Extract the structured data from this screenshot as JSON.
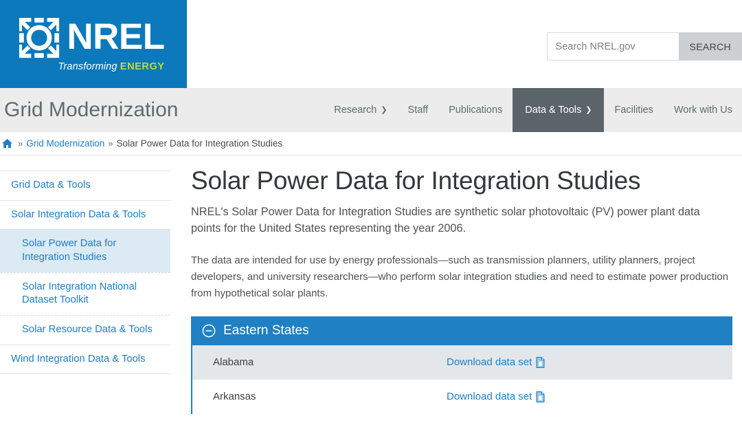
{
  "masthead": {
    "logo": {
      "mark_name": "nrel-ring-icon",
      "wordmark": "NREL",
      "tagline_prefix": "Transforming ",
      "tagline_accent": "ENERGY",
      "background": "#0b79bc",
      "accent_color": "#c8d92b"
    },
    "search": {
      "placeholder": "Search NREL.gov",
      "value": "",
      "button_label": "SEARCH"
    }
  },
  "nav": {
    "site_title": "Grid Modernization",
    "items": [
      {
        "label": "Research",
        "has_caret": true,
        "active": false
      },
      {
        "label": "Staff",
        "has_caret": false,
        "active": false
      },
      {
        "label": "Publications",
        "has_caret": false,
        "active": false
      },
      {
        "label": "Data & Tools",
        "has_caret": true,
        "active": true
      },
      {
        "label": "Facilities",
        "has_caret": false,
        "active": false
      },
      {
        "label": "Work with Us",
        "has_caret": false,
        "active": false
      }
    ],
    "active_background": "#5a6469"
  },
  "breadcrumb": {
    "home_icon": "home-icon",
    "separator": "»",
    "items": [
      {
        "label": "Grid Modernization",
        "is_link": true
      },
      {
        "label": "Solar Power Data for Integration Studies",
        "is_link": false
      }
    ]
  },
  "sidebar": {
    "items": [
      {
        "label": "Grid Data & Tools",
        "level": 1,
        "active": false
      },
      {
        "label": "Solar Integration Data & Tools",
        "level": 1,
        "active": false
      },
      {
        "label": "Solar Power Data for Integration Studies",
        "level": 2,
        "active": true
      },
      {
        "label": "Solar Integration National Dataset Toolkit",
        "level": 2,
        "active": false
      },
      {
        "label": "Solar Resource Data & Tools",
        "level": 2,
        "active": false
      },
      {
        "label": "Wind Integration Data & Tools",
        "level": 1,
        "active": false
      }
    ],
    "active_background": "#dceaf4",
    "link_color": "#1f7ec4"
  },
  "main": {
    "title": "Solar Power Data for Integration Studies",
    "lede": "NREL's Solar Power Data for Integration Studies are synthetic solar photovoltaic (PV) power plant data points for the United States representing the year 2006.",
    "paragraph": "The data are intended for use by energy professionals—such as transmission planners, utility planners, project developers, and university researchers—who perform solar integration studies and need to estimate power production from hypothetical solar plants.",
    "accordion": {
      "title": "Eastern States",
      "expanded": true,
      "toggle_icon": "minus-circle-icon",
      "header_color": "#1f80c4",
      "rows": [
        {
          "state": "Alabama",
          "link_label": "Download data set",
          "link_icon": "document-download-icon"
        },
        {
          "state": "Arkansas",
          "link_label": "Download data set",
          "link_icon": "document-download-icon"
        }
      ]
    }
  }
}
